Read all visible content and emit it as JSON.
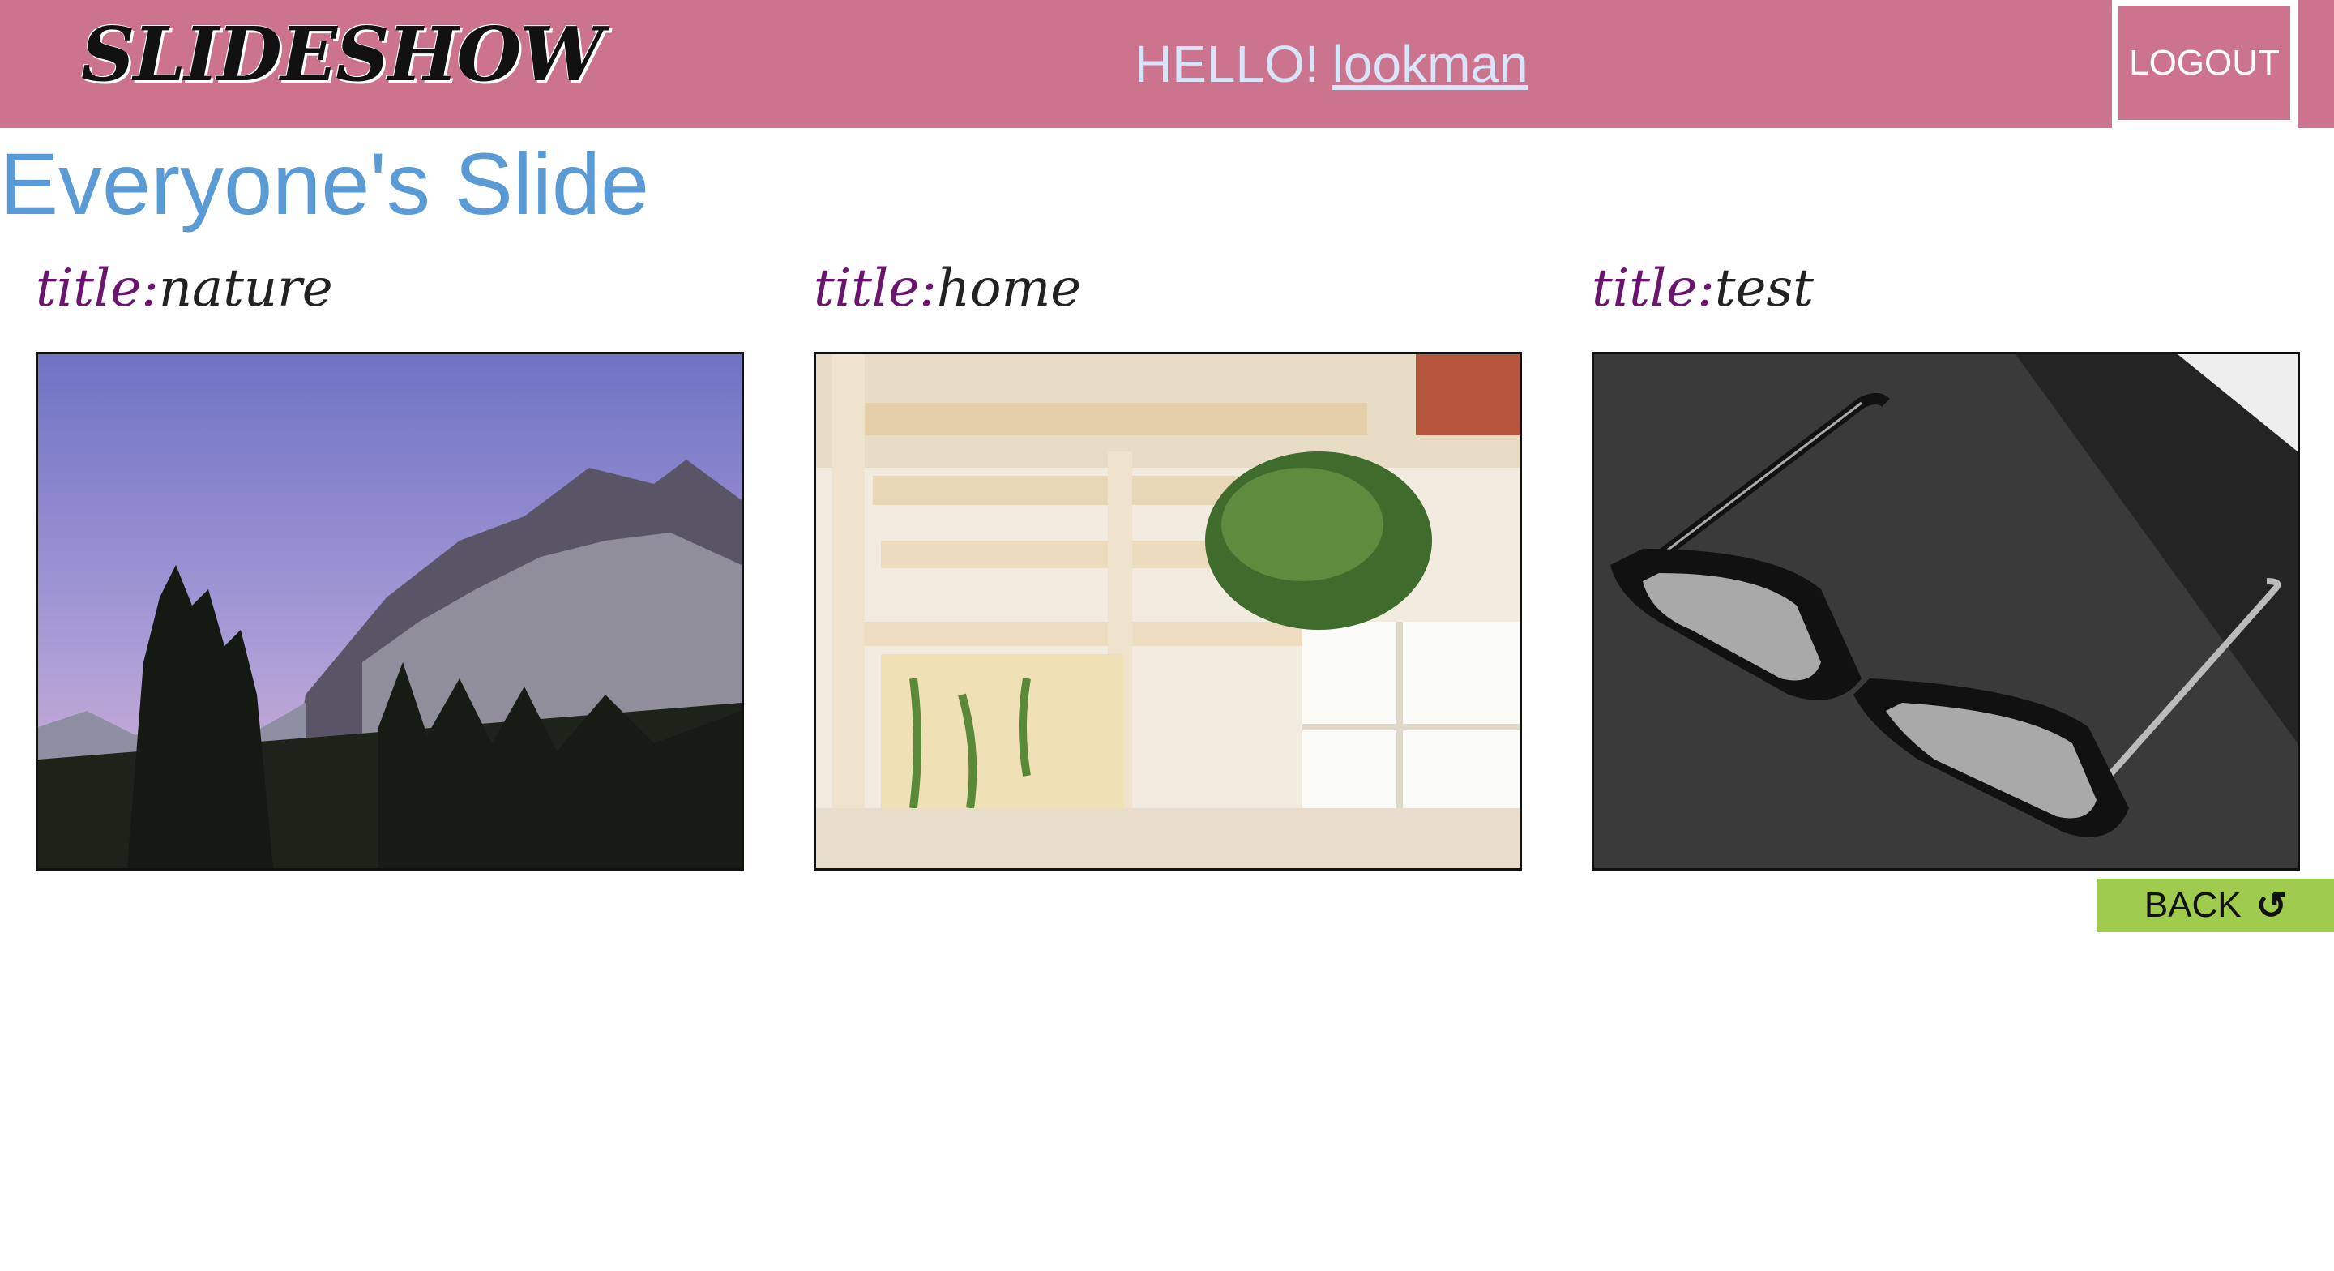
{
  "header": {
    "logo": "SLIDESHOW",
    "greeting": "HELLO!",
    "username": "lookman",
    "logout_label": "LOGOUT"
  },
  "page": {
    "title": "Everyone's Slide"
  },
  "slides": [
    {
      "label": "title:",
      "title": "nature",
      "image": "mountain-photo"
    },
    {
      "label": "title:",
      "title": "home",
      "image": "interior-photo"
    },
    {
      "label": "title:",
      "title": "test",
      "image": "glasses-photo"
    }
  ],
  "back": {
    "label": "BACK",
    "icon": "undo-icon"
  },
  "colors": {
    "header_bg": "#cc748d",
    "title_blue": "#5b9bd5",
    "label_purple": "#6b1570",
    "back_green": "#9fcc4f"
  }
}
